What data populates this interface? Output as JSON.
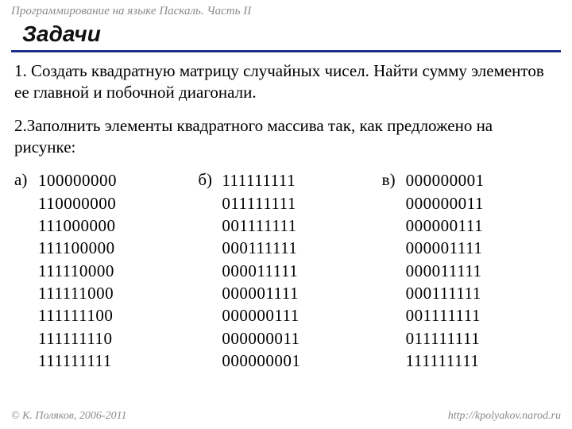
{
  "header": {
    "course": "Программирование на языке Паскаль. Часть II"
  },
  "title": "Задачи",
  "tasks": {
    "t1": "1. Создать квадратную матрицу случайных чисел. Найти сумму элементов ее главной и побочной диагонали.",
    "t2": "2.Заполнить элементы квадратного массива так, как предложено на рисунке:"
  },
  "matrices": {
    "a": {
      "label": "а)",
      "rows": [
        "100000000",
        "110000000",
        "111000000",
        "111100000",
        "111110000",
        "111111000",
        "111111100",
        "111111110",
        "111111111"
      ]
    },
    "b": {
      "label": "б)",
      "rows": [
        "111111111",
        "011111111",
        "001111111",
        "000111111",
        "000011111",
        "000001111",
        "000000111",
        "000000011",
        "000000001"
      ]
    },
    "c": {
      "label": "в)",
      "rows": [
        "000000001",
        "000000011",
        "000000111",
        "000001111",
        "000011111",
        "000111111",
        "001111111",
        "011111111",
        "111111111"
      ]
    }
  },
  "footer": {
    "left": "© К. Поляков, 2006-2011",
    "right": "http://kpolyakov.narod.ru"
  }
}
